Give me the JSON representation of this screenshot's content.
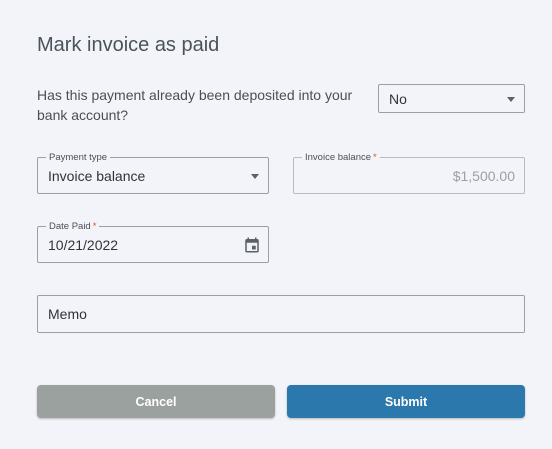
{
  "dialog": {
    "title": "Mark invoice as paid",
    "deposit_question": "Has this payment already been deposited into your bank account?",
    "deposit_value": "No"
  },
  "form": {
    "payment_type": {
      "label": "Payment type",
      "value": "Invoice balance"
    },
    "invoice_balance": {
      "label": "Invoice balance",
      "required_mark": "*",
      "value": "$1,500.00"
    },
    "date_paid": {
      "label": "Date Paid",
      "required_mark": "*",
      "value": "10/21/2022"
    },
    "memo": {
      "placeholder": "Memo"
    }
  },
  "actions": {
    "cancel_label": "Cancel",
    "submit_label": "Submit"
  },
  "colors": {
    "background": "#f3f4f9",
    "cancel": "#9ba19f",
    "submit": "#2a78ac",
    "required": "#d6541c"
  },
  "icons": {
    "dropdown": "chevron-down-icon",
    "calendar": "calendar-icon"
  }
}
